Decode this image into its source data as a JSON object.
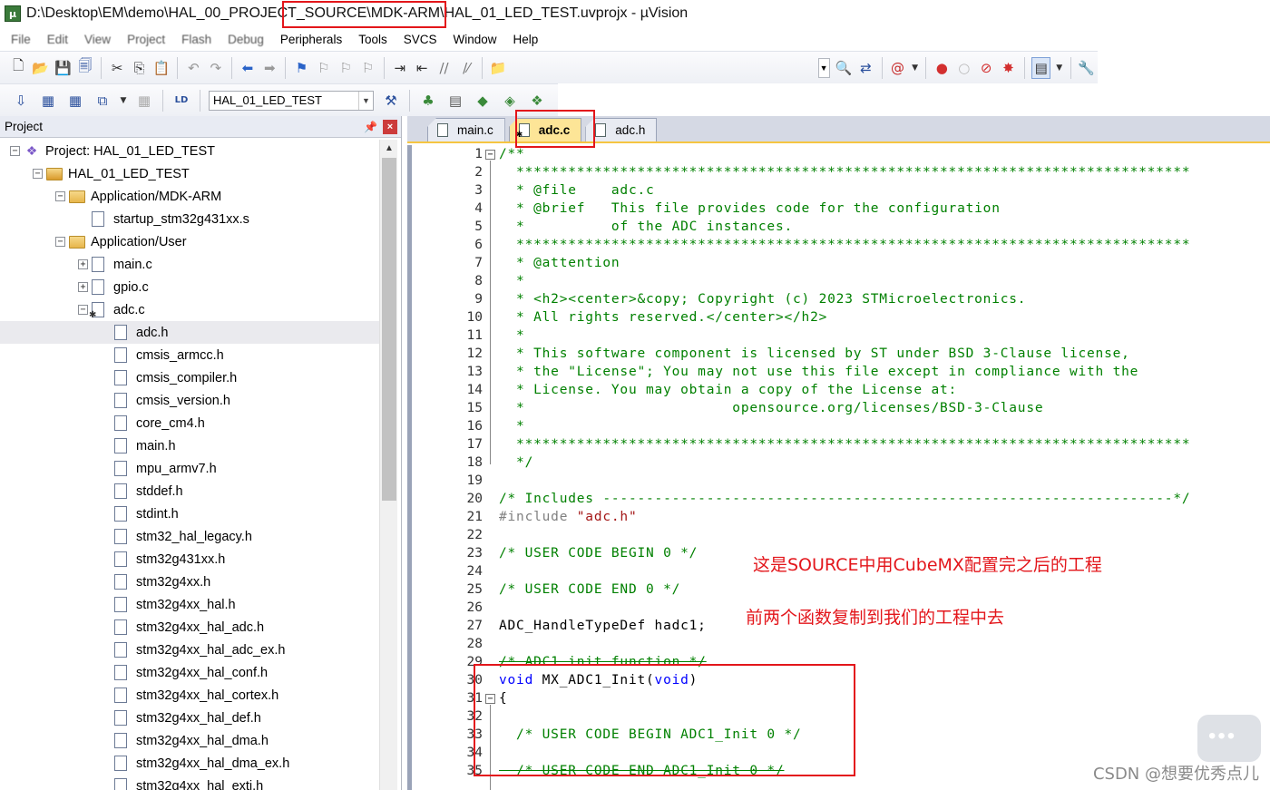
{
  "window": {
    "title_prefix": "D:\\Desktop\\EM\\demo\\HAL_00_PROJEC",
    "title_highlight": "T_SOURCE\\MDK-ARM\\H",
    "title_suffix": "AL_01_LED_TEST.uvprojx - µVision",
    "app_icon": "uvision-icon"
  },
  "menu": {
    "items": [
      "File",
      "Edit",
      "View",
      "Project",
      "Flash",
      "Debug",
      "Peripherals",
      "Tools",
      "SVCS",
      "Window",
      "Help"
    ]
  },
  "toolbar": {
    "target": "HAL_01_LED_TEST",
    "icons_row1": [
      "new-file-icon",
      "open-icon",
      "save-icon",
      "save-all-icon",
      "cut-icon",
      "copy-icon",
      "paste-icon",
      "undo-icon",
      "redo-icon",
      "nav-back-icon",
      "nav-forward-icon",
      "bookmark-icon",
      "prev-bookmark-icon",
      "next-bookmark-icon",
      "clear-bookmarks-icon",
      "indent-icon",
      "unindent-icon",
      "comment-icon",
      "uncomment-icon",
      "find-in-files-icon",
      "find-icon",
      "incremental-find-icon",
      "debug-icon",
      "breakpoint-icon",
      "disable-breakpoint-icon",
      "kill-breakpoints-icon",
      "window-icon",
      "configure-icon"
    ],
    "icons_row2": [
      "translate-icon",
      "build-icon",
      "rebuild-icon",
      "batch-build-icon",
      "stop-build-icon",
      "download-icon",
      "target-options-icon",
      "manage-components-icon",
      "file-extensions-icon",
      "pack-installer-icon",
      "select-packs-icon"
    ]
  },
  "project_panel": {
    "title": "Project",
    "tree": [
      {
        "label": "Project: HAL_01_LED_TEST",
        "level": 0,
        "type": "project",
        "expander": "-"
      },
      {
        "label": "HAL_01_LED_TEST",
        "level": 1,
        "type": "target",
        "expander": "-"
      },
      {
        "label": "Application/MDK-ARM",
        "level": 2,
        "type": "folder",
        "expander": "-"
      },
      {
        "label": "startup_stm32g431xx.s",
        "level": 3,
        "type": "file",
        "expander": ""
      },
      {
        "label": "Application/User",
        "level": 2,
        "type": "folder",
        "expander": "-"
      },
      {
        "label": "main.c",
        "level": 3,
        "type": "file",
        "expander": "+"
      },
      {
        "label": "gpio.c",
        "level": 3,
        "type": "file",
        "expander": "+"
      },
      {
        "label": "adc.c",
        "level": 3,
        "type": "file-gear",
        "expander": "-"
      },
      {
        "label": "adc.h",
        "level": 4,
        "type": "file",
        "expander": "",
        "selected": true
      },
      {
        "label": "cmsis_armcc.h",
        "level": 4,
        "type": "file",
        "expander": ""
      },
      {
        "label": "cmsis_compiler.h",
        "level": 4,
        "type": "file",
        "expander": ""
      },
      {
        "label": "cmsis_version.h",
        "level": 4,
        "type": "file",
        "expander": ""
      },
      {
        "label": "core_cm4.h",
        "level": 4,
        "type": "file",
        "expander": ""
      },
      {
        "label": "main.h",
        "level": 4,
        "type": "file",
        "expander": ""
      },
      {
        "label": "mpu_armv7.h",
        "level": 4,
        "type": "file",
        "expander": ""
      },
      {
        "label": "stddef.h",
        "level": 4,
        "type": "file",
        "expander": ""
      },
      {
        "label": "stdint.h",
        "level": 4,
        "type": "file",
        "expander": ""
      },
      {
        "label": "stm32_hal_legacy.h",
        "level": 4,
        "type": "file",
        "expander": ""
      },
      {
        "label": "stm32g431xx.h",
        "level": 4,
        "type": "file",
        "expander": ""
      },
      {
        "label": "stm32g4xx.h",
        "level": 4,
        "type": "file",
        "expander": ""
      },
      {
        "label": "stm32g4xx_hal.h",
        "level": 4,
        "type": "file",
        "expander": ""
      },
      {
        "label": "stm32g4xx_hal_adc.h",
        "level": 4,
        "type": "file",
        "expander": ""
      },
      {
        "label": "stm32g4xx_hal_adc_ex.h",
        "level": 4,
        "type": "file",
        "expander": ""
      },
      {
        "label": "stm32g4xx_hal_conf.h",
        "level": 4,
        "type": "file",
        "expander": ""
      },
      {
        "label": "stm32g4xx_hal_cortex.h",
        "level": 4,
        "type": "file",
        "expander": ""
      },
      {
        "label": "stm32g4xx_hal_def.h",
        "level": 4,
        "type": "file",
        "expander": ""
      },
      {
        "label": "stm32g4xx_hal_dma.h",
        "level": 4,
        "type": "file",
        "expander": ""
      },
      {
        "label": "stm32g4xx_hal_dma_ex.h",
        "level": 4,
        "type": "file",
        "expander": ""
      },
      {
        "label": "stm32g4xx_hal_exti.h",
        "level": 4,
        "type": "file",
        "expander": ""
      }
    ]
  },
  "editor": {
    "tabs": [
      {
        "label": "main.c",
        "active": false,
        "gear": false
      },
      {
        "label": "adc.c",
        "active": true,
        "gear": true
      },
      {
        "label": "adc.h",
        "active": false,
        "gear": false
      }
    ],
    "lines": [
      {
        "n": "1",
        "text": "/**",
        "cls": "c"
      },
      {
        "n": "2",
        "text": "  ******************************************************************************",
        "cls": "c"
      },
      {
        "n": "3",
        "text": "  * @file    adc.c",
        "cls": "c"
      },
      {
        "n": "4",
        "text": "  * @brief   This file provides code for the configuration",
        "cls": "c"
      },
      {
        "n": "5",
        "text": "  *          of the ADC instances.",
        "cls": "c"
      },
      {
        "n": "6",
        "text": "  ******************************************************************************",
        "cls": "c"
      },
      {
        "n": "7",
        "text": "  * @attention",
        "cls": "c"
      },
      {
        "n": "8",
        "text": "  *",
        "cls": "c"
      },
      {
        "n": "9",
        "text": "  * <h2><center>&copy; Copyright (c) 2023 STMicroelectronics.",
        "cls": "c"
      },
      {
        "n": "10",
        "text": "  * All rights reserved.</center></h2>",
        "cls": "c"
      },
      {
        "n": "11",
        "text": "  *",
        "cls": "c"
      },
      {
        "n": "12",
        "text": "  * This software component is licensed by ST under BSD 3-Clause license,",
        "cls": "c"
      },
      {
        "n": "13",
        "text": "  * the \"License\"; You may not use this file except in compliance with the",
        "cls": "c"
      },
      {
        "n": "14",
        "text": "  * License. You may obtain a copy of the License at:",
        "cls": "c"
      },
      {
        "n": "15",
        "text": "  *                        opensource.org/licenses/BSD-3-Clause",
        "cls": "c"
      },
      {
        "n": "16",
        "text": "  *",
        "cls": "c"
      },
      {
        "n": "17",
        "text": "  ******************************************************************************",
        "cls": "c"
      },
      {
        "n": "18",
        "text": "  */",
        "cls": "c"
      },
      {
        "n": "19",
        "text": "",
        "cls": "c"
      },
      {
        "n": "20",
        "text": "/* Includes ------------------------------------------------------------------*/",
        "cls": "c"
      },
      {
        "n": "21",
        "text": "#include \"adc.h\"",
        "cls": "inc"
      },
      {
        "n": "22",
        "text": "",
        "cls": "c"
      },
      {
        "n": "23",
        "text": "/* USER CODE BEGIN 0 */",
        "cls": "c"
      },
      {
        "n": "24",
        "text": "",
        "cls": "c"
      },
      {
        "n": "25",
        "text": "/* USER CODE END 0 */",
        "cls": "c"
      },
      {
        "n": "26",
        "text": "",
        "cls": "c"
      },
      {
        "n": "27",
        "text": "ADC_HandleTypeDef hadc1;",
        "cls": "plain"
      },
      {
        "n": "28",
        "text": "",
        "cls": "c"
      },
      {
        "n": "29",
        "text": "/* ADC1 init function */",
        "cls": "c"
      },
      {
        "n": "30",
        "text": "void MX_ADC1_Init(void)",
        "cls": "fn"
      },
      {
        "n": "31",
        "text": "{",
        "cls": "plain"
      },
      {
        "n": "32",
        "text": "",
        "cls": "c"
      },
      {
        "n": "33",
        "text": "  /* USER CODE BEGIN ADC1_Init 0 */",
        "cls": "c"
      },
      {
        "n": "34",
        "text": "",
        "cls": "c"
      },
      {
        "n": "35",
        "text": "  /* USER CODE END ADC1_Init 0 */",
        "cls": "c"
      }
    ]
  },
  "annotations": {
    "note1": "这是SOURCE中用CubeMX配置完之后的工程",
    "note2": "前两个函数复制到我们的工程中去",
    "color": "#e3161b"
  },
  "watermark": "CSDN @想要优秀点儿"
}
